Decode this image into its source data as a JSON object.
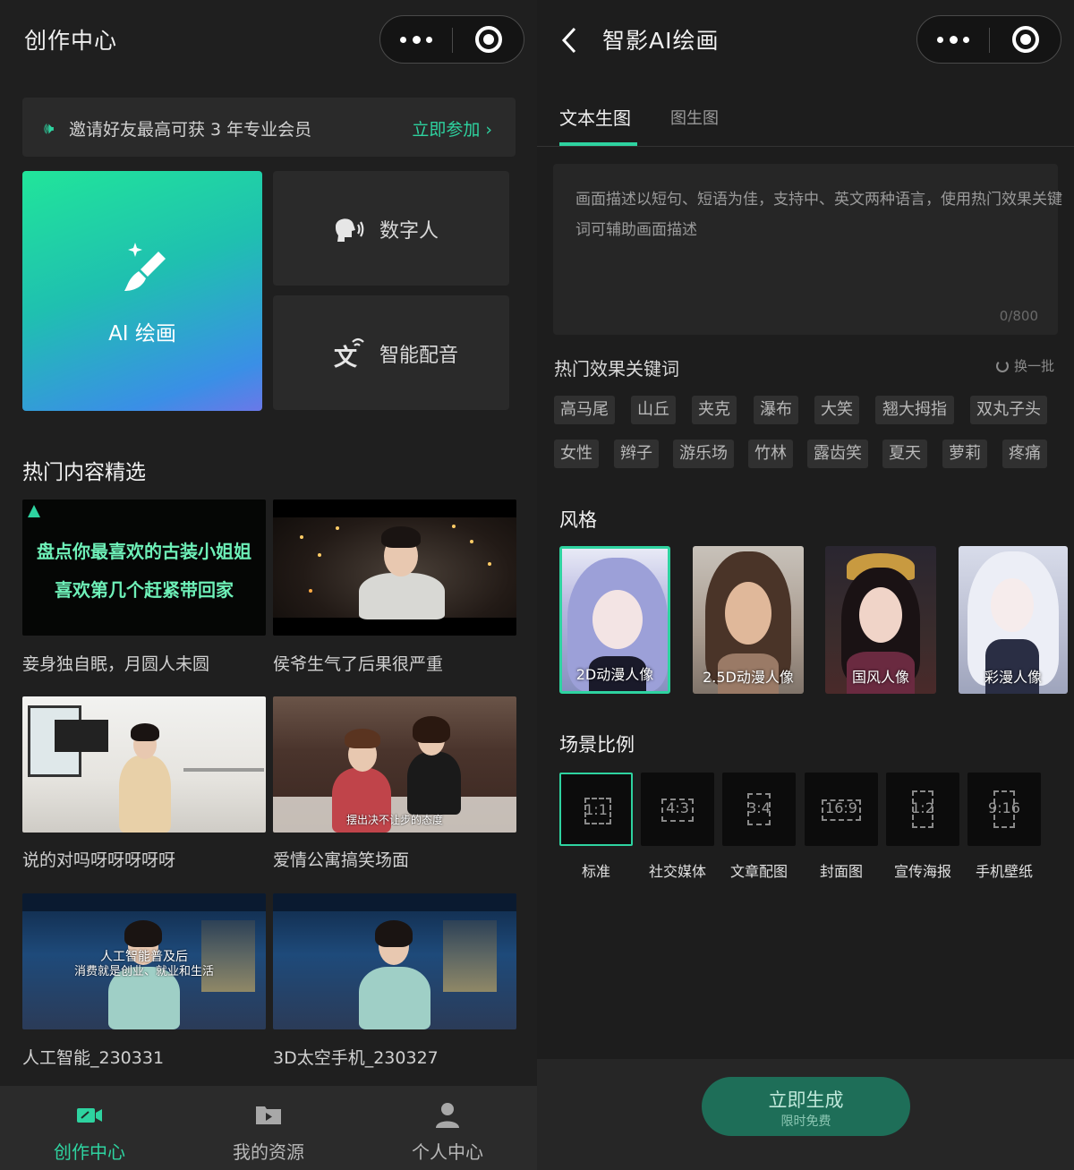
{
  "left": {
    "header": {
      "title": "创作中心"
    },
    "banner": {
      "text": "邀请好友最高可获 3 年专业会员",
      "action": "立即参加 ›"
    },
    "cards": {
      "ai": "AI 绘画",
      "digital_human": "数字人",
      "voice": "智能配音"
    },
    "section_title": "热门内容精选",
    "videos": [
      {
        "caption": "妾身独自眠，月圆人未圆",
        "line1": "盘点你最喜欢的古装小姐姐",
        "line2": "喜欢第几个赶紧带回家"
      },
      {
        "caption": "侯爷生气了后果很严重"
      },
      {
        "caption": "说的对吗呀呀呀呀呀"
      },
      {
        "caption": "爱情公寓搞笑场面",
        "subtitle": "摆出决不让步的态度"
      },
      {
        "caption": "人工智能_230331",
        "overlay1": "人工智能普及后",
        "overlay2": "消费就是创业、就业和生活"
      },
      {
        "caption": "3D太空手机_230327"
      }
    ],
    "tabbar": [
      {
        "label": "创作中心",
        "icon": "camera-icon",
        "active": true
      },
      {
        "label": "我的资源",
        "icon": "folder-icon",
        "active": false
      },
      {
        "label": "个人中心",
        "icon": "user-icon",
        "active": false
      }
    ]
  },
  "right": {
    "header": {
      "title": "智影AI绘画"
    },
    "tabs": [
      {
        "label": "文本生图",
        "active": true
      },
      {
        "label": "图生图",
        "active": false
      }
    ],
    "prompt": {
      "placeholder": "画面描述以短句、短语为佳，支持中、英文两种语言，使用热门效果关键词可辅助画面描述",
      "counter": "0/800"
    },
    "keywords_title": "热门效果关键词",
    "refresh_label": "换一批",
    "keywords": [
      "高马尾",
      "山丘",
      "夹克",
      "瀑布",
      "大笑",
      "翘大拇指",
      "双丸子头",
      "女性",
      "辫子",
      "游乐场",
      "竹林",
      "露齿笑",
      "夏天",
      "萝莉",
      "疼痛"
    ],
    "style_title": "风格",
    "styles": [
      {
        "label": "2D动漫人像",
        "selected": true
      },
      {
        "label": "2.5D动漫人像",
        "selected": false
      },
      {
        "label": "国风人像",
        "selected": false
      },
      {
        "label": "彩漫人像",
        "selected": false
      }
    ],
    "ratio_title": "场景比例",
    "ratios": [
      {
        "value": "1:1",
        "label": "标准",
        "selected": true
      },
      {
        "value": "4:3",
        "label": "社交媒体",
        "selected": false
      },
      {
        "value": "3:4",
        "label": "文章配图",
        "selected": false
      },
      {
        "value": "16:9",
        "label": "封面图",
        "selected": false
      },
      {
        "value": "1:2",
        "label": "宣传海报",
        "selected": false
      },
      {
        "value": "9:16",
        "label": "手机壁纸",
        "selected": false
      }
    ],
    "generate": {
      "label": "立即生成",
      "sub": "限时免费"
    }
  },
  "colors": {
    "accent": "#2ed3a0",
    "background": "#1f1f1f",
    "card": "#2a2a2a"
  }
}
